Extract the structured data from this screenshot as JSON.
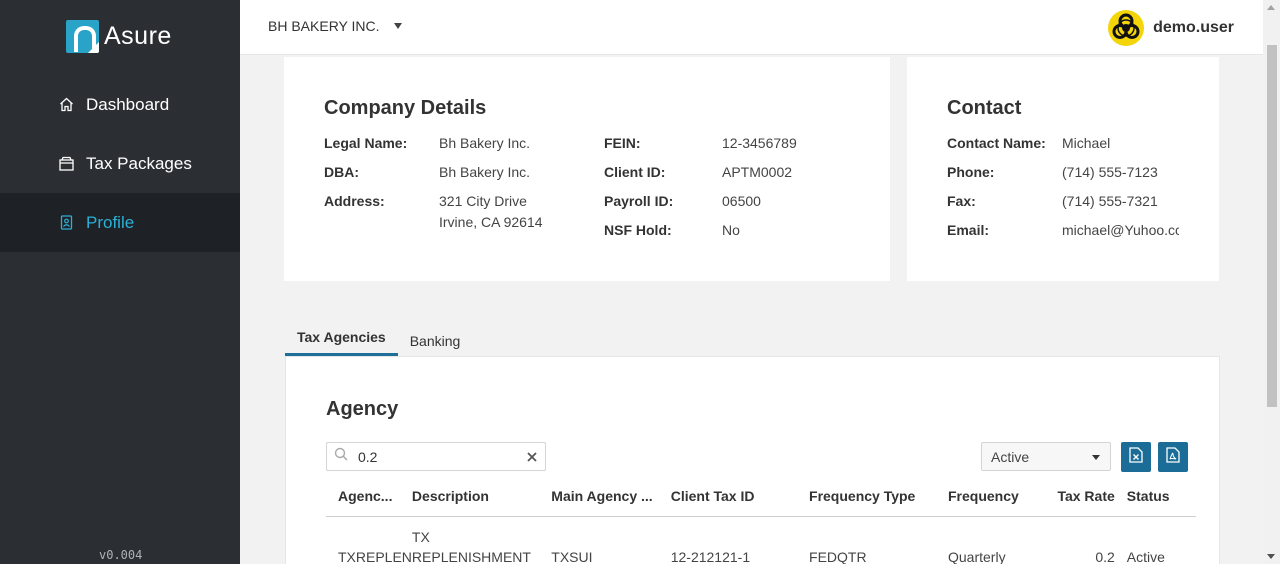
{
  "app": {
    "logo_text": "Asure",
    "version": "v0.004"
  },
  "sidebar": {
    "items": [
      {
        "label": "Dashboard",
        "icon": "home-icon"
      },
      {
        "label": "Tax Packages",
        "icon": "package-icon"
      },
      {
        "label": "Profile",
        "icon": "profile-icon",
        "active": true
      }
    ]
  },
  "header": {
    "company": "BH BAKERY INC.",
    "user": "demo.user",
    "avatar_icon": "biohazard-icon"
  },
  "company_details": {
    "title": "Company Details",
    "legal_name_label": "Legal Name:",
    "legal_name": "Bh Bakery Inc.",
    "dba_label": "DBA:",
    "dba": "Bh Bakery Inc.",
    "address_label": "Address:",
    "address_line1": "321 City Drive",
    "address_line2": "Irvine, CA 92614",
    "fein_label": "FEIN:",
    "fein": "12-3456789",
    "client_id_label": "Client ID:",
    "client_id": "APTM0002",
    "payroll_id_label": "Payroll ID:",
    "payroll_id": "06500",
    "nsf_hold_label": "NSF Hold:",
    "nsf_hold": "No"
  },
  "contact": {
    "title": "Contact",
    "name_label": "Contact Name:",
    "name": "Michael",
    "phone_label": "Phone:",
    "phone": "(714) 555-7123",
    "fax_label": "Fax:",
    "fax": "(714) 555-7321",
    "email_label": "Email:",
    "email": "michael@Yuhoo.cc"
  },
  "tabs": {
    "tax_agencies": "Tax Agencies",
    "banking": "Banking"
  },
  "agency": {
    "title": "Agency",
    "search_value": "0.2",
    "status_filter": "Active",
    "columns": [
      "Agenc...",
      "Description",
      "Main Agency ...",
      "Client Tax ID",
      "Frequency Type",
      "Frequency",
      "Tax Rate",
      "Status"
    ],
    "rows": [
      {
        "agency": "TXREPLEN",
        "description_line1": "TX",
        "description_line2": "REPLENISHMENT",
        "main_agency": "TXSUI",
        "client_tax_id": "12-212121-1",
        "frequency_type": "FEDQTR",
        "frequency": "Quarterly",
        "tax_rate": "0.2",
        "status": "Active"
      }
    ]
  },
  "colors": {
    "sidebar": "#2b2f34",
    "active_nav": "#1e2226",
    "accent": "#2bb0d6",
    "button": "#1b6d97"
  }
}
